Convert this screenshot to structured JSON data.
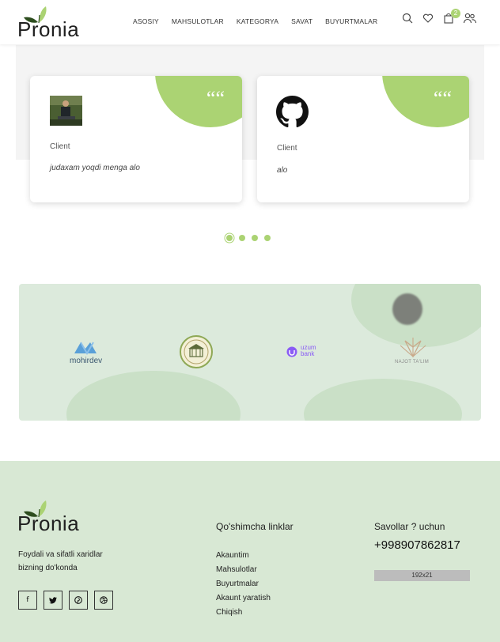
{
  "brand": {
    "name": "Pronia",
    "accent_color": "#abd373"
  },
  "nav": {
    "items": [
      {
        "label": "ASOSIY"
      },
      {
        "label": "MAHSULOTLAR"
      },
      {
        "label": "KATEGORYA"
      },
      {
        "label": "SAVAT"
      },
      {
        "label": "BUYURTMALAR"
      }
    ]
  },
  "header_icons": {
    "search": "search-icon",
    "wishlist": "heart-icon",
    "cart": "cart-icon",
    "cart_count": "2",
    "account": "users-icon"
  },
  "testimonials": [
    {
      "avatar": "photo",
      "role": "Client",
      "text": "judaxam yoqdi menga alo"
    },
    {
      "avatar": "github-icon",
      "role": "Client",
      "text": "alo"
    }
  ],
  "slider": {
    "dots": 4,
    "active": 0
  },
  "partners": [
    {
      "name": "mohirdev"
    },
    {
      "name": "seal-emblem"
    },
    {
      "name": "uzum bank"
    },
    {
      "name": "NAJOT TA'LIM"
    }
  ],
  "footer": {
    "description": "Foydali va sifatli xaridlar bizning do'konda",
    "socials": [
      "facebook-icon",
      "twitter-icon",
      "pinterest-icon",
      "dribbble-icon"
    ],
    "links_title": "Qo'shimcha linklar",
    "links": [
      "Akauntim",
      "Mahsulotlar",
      "Buyurtmalar",
      "Akaunt yaratish",
      "Chiqish"
    ],
    "contact_title": "Savollar ? uchun",
    "phone": "+998907862817",
    "placeholder_label": "192x21"
  }
}
